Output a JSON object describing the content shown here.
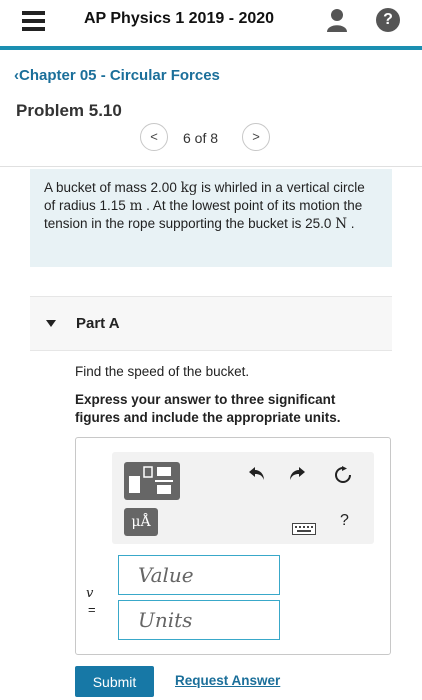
{
  "header": {
    "title": "AP Physics 1 2019 - 2020",
    "menu_icon": "hamburger-menu-icon",
    "user_icon": "user-icon",
    "help_icon": "help-icon",
    "help_symbol": "?",
    "accent_color": "#1b8fb1"
  },
  "nav": {
    "chapter_link": "‹Chapter 05 - Circular Forces",
    "problem_title": "Problem 5.10",
    "prev_symbol": "<",
    "next_symbol": ">",
    "pager_text": "6 of 8"
  },
  "problem": {
    "text_1": "A bucket of mass 2.00 ",
    "unit_mass": "kg",
    "text_2": " is whirled in a vertical circle of radius 1.15 ",
    "unit_length": "m",
    "text_3": " . At the lowest point of its motion the tension in the rope supporting the bucket is 25.0 ",
    "unit_force": "N",
    "text_4": " ."
  },
  "part": {
    "label": "Part A",
    "question": "Find the speed of the bucket.",
    "instructions": "Express your answer to three significant figures and include the appropriate units."
  },
  "answer": {
    "toolbar_mu_label": "μÅ",
    "toolbar_help": "?",
    "variable": "v",
    "equals": "=",
    "value_placeholder": "Value",
    "units_placeholder": "Units"
  },
  "actions": {
    "submit_label": "Submit",
    "request_label": "Request Answer",
    "submit_color": "#1778a6"
  }
}
